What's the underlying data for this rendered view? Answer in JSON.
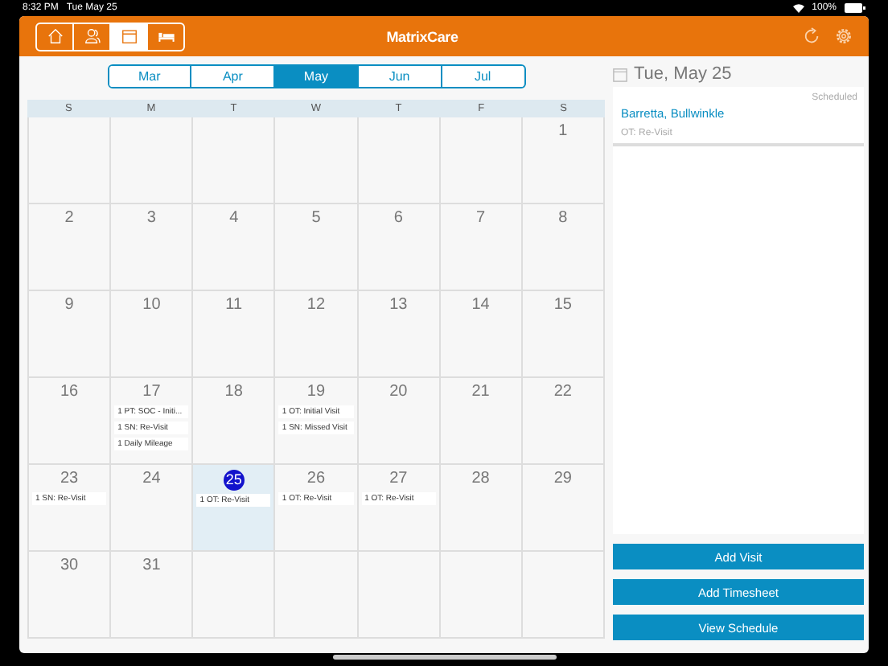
{
  "status_bar": {
    "time": "8:32 PM",
    "date": "Tue May 25",
    "battery": "100%"
  },
  "nav": [
    {
      "kind": "home",
      "selected": false
    },
    {
      "kind": "people",
      "selected": false
    },
    {
      "kind": "calendar",
      "selected": true
    },
    {
      "kind": "bed",
      "selected": false
    }
  ],
  "logo": "MatrixCare",
  "months": [
    {
      "label": "Mar",
      "selected": false
    },
    {
      "label": "Apr",
      "selected": false
    },
    {
      "label": "May",
      "selected": true
    },
    {
      "label": "Jun",
      "selected": false
    },
    {
      "label": "Jul",
      "selected": false
    }
  ],
  "weekdays": [
    "S",
    "M",
    "T",
    "W",
    "T",
    "F",
    "S"
  ],
  "weeks": [
    [
      {
        "kind": "empty"
      },
      {
        "kind": "empty"
      },
      {
        "kind": "empty"
      },
      {
        "kind": "empty"
      },
      {
        "kind": "empty"
      },
      {
        "kind": "empty"
      },
      {
        "kind": "day",
        "day": "1",
        "today": false
      }
    ],
    [
      {
        "kind": "day",
        "day": "2",
        "today": false
      },
      {
        "kind": "day",
        "day": "3",
        "today": false
      },
      {
        "kind": "day",
        "day": "4",
        "today": false
      },
      {
        "kind": "day",
        "day": "5",
        "today": false
      },
      {
        "kind": "day",
        "day": "6",
        "today": false
      },
      {
        "kind": "day",
        "day": "7",
        "today": false
      },
      {
        "kind": "day",
        "day": "8",
        "today": false
      }
    ],
    [
      {
        "kind": "day",
        "day": "9",
        "today": false
      },
      {
        "kind": "day",
        "day": "10",
        "today": false
      },
      {
        "kind": "day",
        "day": "11",
        "today": false
      },
      {
        "kind": "day",
        "day": "12",
        "today": false
      },
      {
        "kind": "day",
        "day": "13",
        "today": false
      },
      {
        "kind": "day",
        "day": "14",
        "today": false
      },
      {
        "kind": "day",
        "day": "15",
        "today": false
      }
    ],
    [
      {
        "kind": "day",
        "day": "16",
        "today": false
      },
      {
        "kind": "day",
        "day": "17",
        "today": false,
        "events": [
          "1 PT: SOC - Initi...",
          "1 SN: Re-Visit",
          "1 Daily Mileage"
        ]
      },
      {
        "kind": "day",
        "day": "18",
        "today": false
      },
      {
        "kind": "day",
        "day": "19",
        "today": false,
        "events": [
          "1 OT: Initial Visit",
          "1 SN: Missed Visit"
        ]
      },
      {
        "kind": "day",
        "day": "20",
        "today": false
      },
      {
        "kind": "day",
        "day": "21",
        "today": false
      },
      {
        "kind": "day",
        "day": "22",
        "today": false
      }
    ],
    [
      {
        "kind": "day",
        "day": "23",
        "today": false,
        "events": [
          "1 SN: Re-Visit"
        ]
      },
      {
        "kind": "day",
        "day": "24",
        "today": false
      },
      {
        "kind": "day",
        "day": "25",
        "today": true,
        "events": [
          "1 OT: Re-Visit"
        ]
      },
      {
        "kind": "day",
        "day": "26",
        "today": false,
        "events": [
          "1 OT: Re-Visit"
        ]
      },
      {
        "kind": "day",
        "day": "27",
        "today": false,
        "events": [
          "1 OT: Re-Visit"
        ]
      },
      {
        "kind": "day",
        "day": "28",
        "today": false
      },
      {
        "kind": "day",
        "day": "29",
        "today": false
      }
    ],
    [
      {
        "kind": "day",
        "day": "30",
        "today": false
      },
      {
        "kind": "day",
        "day": "31",
        "today": false
      },
      {
        "kind": "empty"
      },
      {
        "kind": "empty"
      },
      {
        "kind": "empty"
      },
      {
        "kind": "empty"
      },
      {
        "kind": "empty"
      }
    ]
  ],
  "detail": {
    "date": "Tue, May 25",
    "visits": [
      {
        "status": "Scheduled",
        "patient": "Barretta, Bullwinkle",
        "type": "OT: Re-Visit"
      }
    ]
  },
  "buttons": [
    "Add Visit",
    "Add Timesheet",
    "View Schedule"
  ]
}
